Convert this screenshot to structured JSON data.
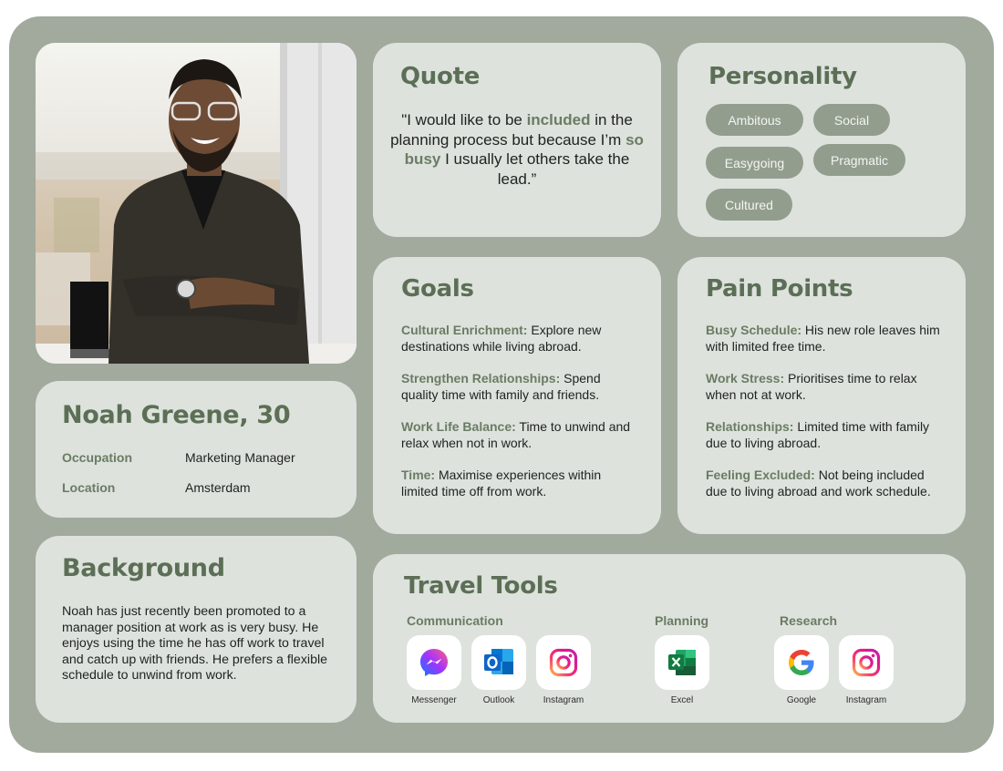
{
  "persona": {
    "name_age": "Noah Greene, 30",
    "photo_alt": "Portrait of smiling man in plaid blazer with arms crossed"
  },
  "details": [
    {
      "label": "Occupation",
      "value": "Marketing Manager"
    },
    {
      "label": "Location",
      "value": "Amsterdam"
    }
  ],
  "quote": {
    "title": "Quote",
    "parts": [
      {
        "text": "\"I would like to be ",
        "accent": false
      },
      {
        "text": "included",
        "accent": true
      },
      {
        "text": " in the planning process but because I’m ",
        "accent": false
      },
      {
        "text": "so busy",
        "accent": true
      },
      {
        "text": " I usually let others take the lead.”",
        "accent": false
      }
    ]
  },
  "personality": {
    "title": "Personality",
    "tags": [
      "Ambitous",
      "Social",
      "Easygoing",
      "Pragmatic",
      "Cultured"
    ]
  },
  "goals": {
    "title": "Goals",
    "items": [
      {
        "key": "Cultural Enrichment:",
        "text": " Explore new destinations while living abroad."
      },
      {
        "key": "Strengthen Relationships:",
        "text": " Spend quality time with family and friends."
      },
      {
        "key": "Work Life Balance:",
        "text": " Time to unwind and relax when not in work."
      },
      {
        "key": "Time:",
        "text": " Maximise experiences within limited time off from work."
      }
    ]
  },
  "pain_points": {
    "title": "Pain Points",
    "items": [
      {
        "key": "Busy Schedule:",
        "text": " His new role leaves him with limited free time."
      },
      {
        "key": "Work Stress:",
        "text": " Prioritises time to relax when not at work."
      },
      {
        "key": "Relationships:",
        "text": " Limited time with family due to living abroad."
      },
      {
        "key": "Feeling Excluded:",
        "text": " Not being included due to living abroad and work schedule."
      }
    ]
  },
  "background": {
    "title": "Background",
    "text": "Noah has just recently been promoted to a manager position at work as is very busy. He enjoys using the time he has off work to travel and catch up with friends. He prefers a flexible schedule to unwind from work."
  },
  "travel_tools": {
    "title": "Travel Tools",
    "groups": [
      {
        "label": "Communication",
        "apps": [
          {
            "name": "Messenger",
            "icon": "messenger-icon"
          },
          {
            "name": "Outlook",
            "icon": "outlook-icon"
          },
          {
            "name": "Instagram",
            "icon": "instagram-icon"
          }
        ]
      },
      {
        "label": "Planning",
        "apps": [
          {
            "name": "Excel",
            "icon": "excel-icon"
          }
        ]
      },
      {
        "label": "Research",
        "apps": [
          {
            "name": "Google",
            "icon": "google-icon"
          },
          {
            "name": "Instagram",
            "icon": "instagram-icon"
          }
        ]
      }
    ]
  },
  "colors": {
    "frame": "#a2a99d",
    "card": "#dde2dd",
    "heading": "#5c6f56",
    "accent": "#6a7c63",
    "tag": "#939d8e"
  }
}
